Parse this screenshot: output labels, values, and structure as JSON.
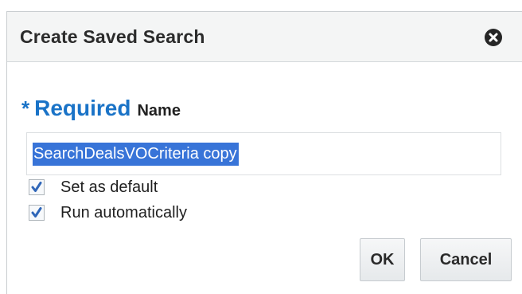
{
  "dialog": {
    "title": "Create Saved Search",
    "close_icon": "close-circle-icon"
  },
  "form": {
    "required_star": "*",
    "required_text": "Required",
    "name_label": "Name",
    "name_value": "SearchDealsVOCriteria copy",
    "name_value_selected": true,
    "set_default_label": "Set as default",
    "set_default_checked": true,
    "run_auto_label": "Run automatically",
    "run_auto_checked": true
  },
  "buttons": {
    "ok_label": "OK",
    "cancel_label": "Cancel"
  },
  "colors": {
    "accent": "#1a73c7",
    "selection": "#3874d8",
    "title_bar": "#f4f5f5"
  }
}
